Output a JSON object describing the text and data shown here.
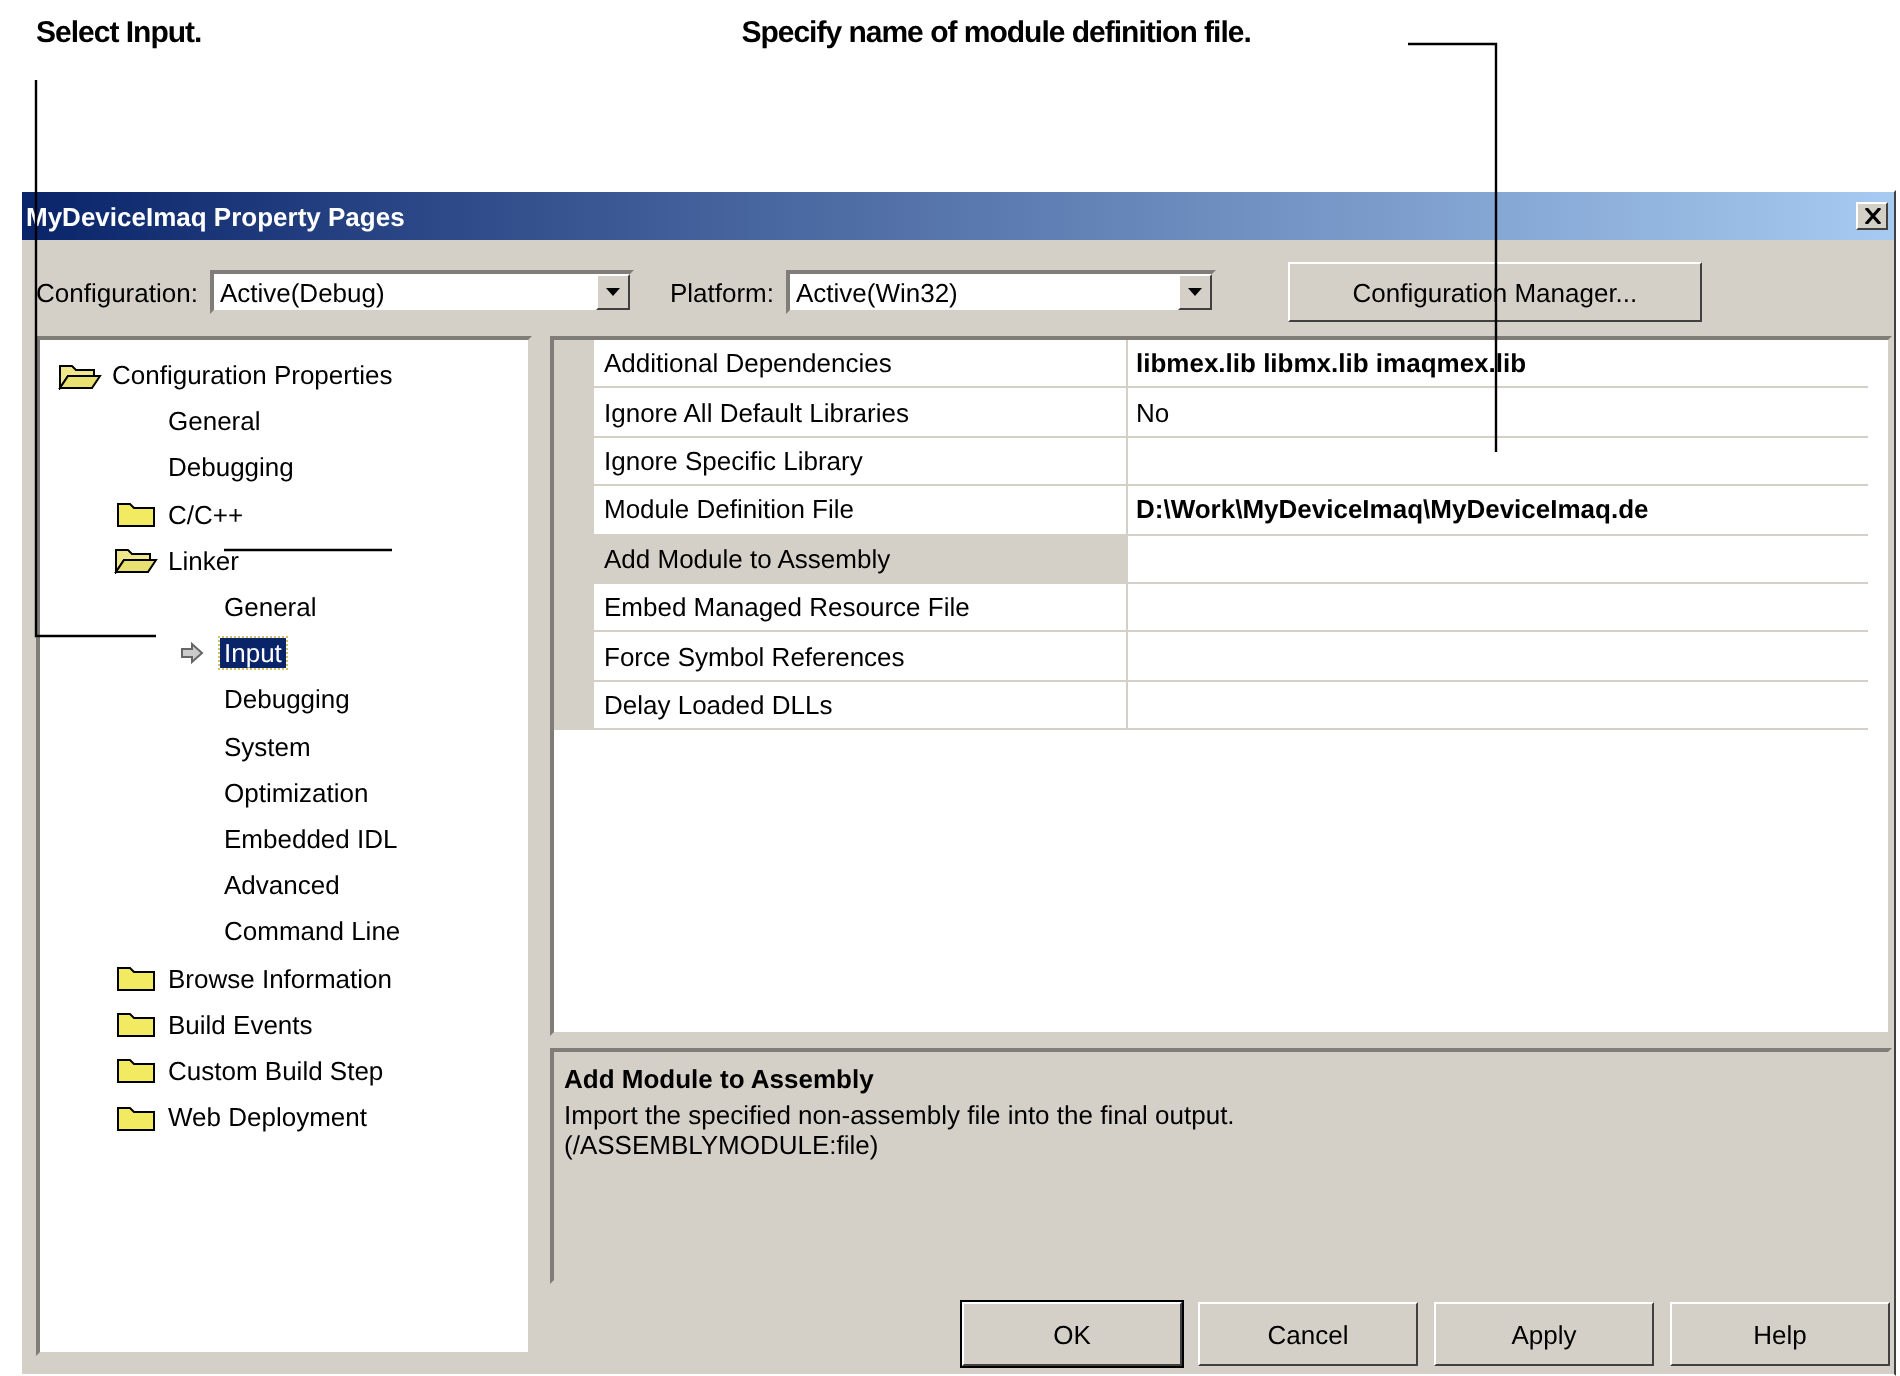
{
  "annotations": [
    {
      "text": "Select Input."
    },
    {
      "text": "Specify name of module definition file."
    }
  ],
  "window": {
    "title": "MyDeviceImaq Property Pages"
  },
  "toolbar": {
    "configuration_label": "Configuration:",
    "configuration_value": "Active(Debug)",
    "platform_label": "Platform:",
    "platform_value": "Active(Win32)",
    "manager_button": "Configuration Manager..."
  },
  "tree": [
    {
      "label": "Configuration Properties",
      "kind": "folder",
      "expanded": true,
      "selected": false,
      "children": [
        {
          "label": "General",
          "kind": "page",
          "selected": false
        },
        {
          "label": "Debugging",
          "kind": "page",
          "selected": false
        },
        {
          "label": "C/C++",
          "kind": "folder",
          "expanded": false,
          "selected": false
        },
        {
          "label": "Linker",
          "kind": "folder",
          "expanded": true,
          "selected": false,
          "children": [
            {
              "label": "General",
              "kind": "page",
              "selected": false
            },
            {
              "label": "Input",
              "kind": "page",
              "selected": true
            },
            {
              "label": "Debugging",
              "kind": "page",
              "selected": false
            },
            {
              "label": "System",
              "kind": "page",
              "selected": false
            },
            {
              "label": "Optimization",
              "kind": "page",
              "selected": false
            },
            {
              "label": "Embedded IDL",
              "kind": "page",
              "selected": false
            },
            {
              "label": "Advanced",
              "kind": "page",
              "selected": false
            },
            {
              "label": "Command Line",
              "kind": "page",
              "selected": false
            }
          ]
        },
        {
          "label": "Browse Information",
          "kind": "folder",
          "expanded": false,
          "selected": false
        },
        {
          "label": "Build Events",
          "kind": "folder",
          "expanded": false,
          "selected": false
        },
        {
          "label": "Custom Build Step",
          "kind": "folder",
          "expanded": false,
          "selected": false
        },
        {
          "label": "Web Deployment",
          "kind": "folder",
          "expanded": false,
          "selected": false
        }
      ]
    }
  ],
  "properties": [
    {
      "name": "Additional Dependencies",
      "value": "libmex.lib libmx.lib imaqmex.lib",
      "modified": true,
      "selected": false
    },
    {
      "name": "Ignore All Default Libraries",
      "value": "No",
      "modified": false,
      "selected": false
    },
    {
      "name": "Ignore Specific Library",
      "selected": false
    },
    {
      "name": "Module Definition File",
      "value": "D:\\Work\\MyDeviceImaq\\MyDeviceImaq.de",
      "modified": true,
      "selected": false
    },
    {
      "name": "Add Module to Assembly",
      "selected": true
    },
    {
      "name": "Embed Managed Resource File",
      "selected": false
    },
    {
      "name": "Force Symbol References",
      "selected": false
    },
    {
      "name": "Delay Loaded DLLs",
      "selected": false
    }
  ],
  "description": {
    "title": "Add Module to Assembly",
    "text": "Import the specified non-assembly file into the final output.",
    "switch": "(/ASSEMBLYMODULE:file)"
  },
  "buttons": [
    {
      "label": "OK",
      "default": true
    },
    {
      "label": "Cancel",
      "default": false
    },
    {
      "label": "Apply",
      "default": false
    },
    {
      "label": "Help",
      "default": false
    }
  ]
}
